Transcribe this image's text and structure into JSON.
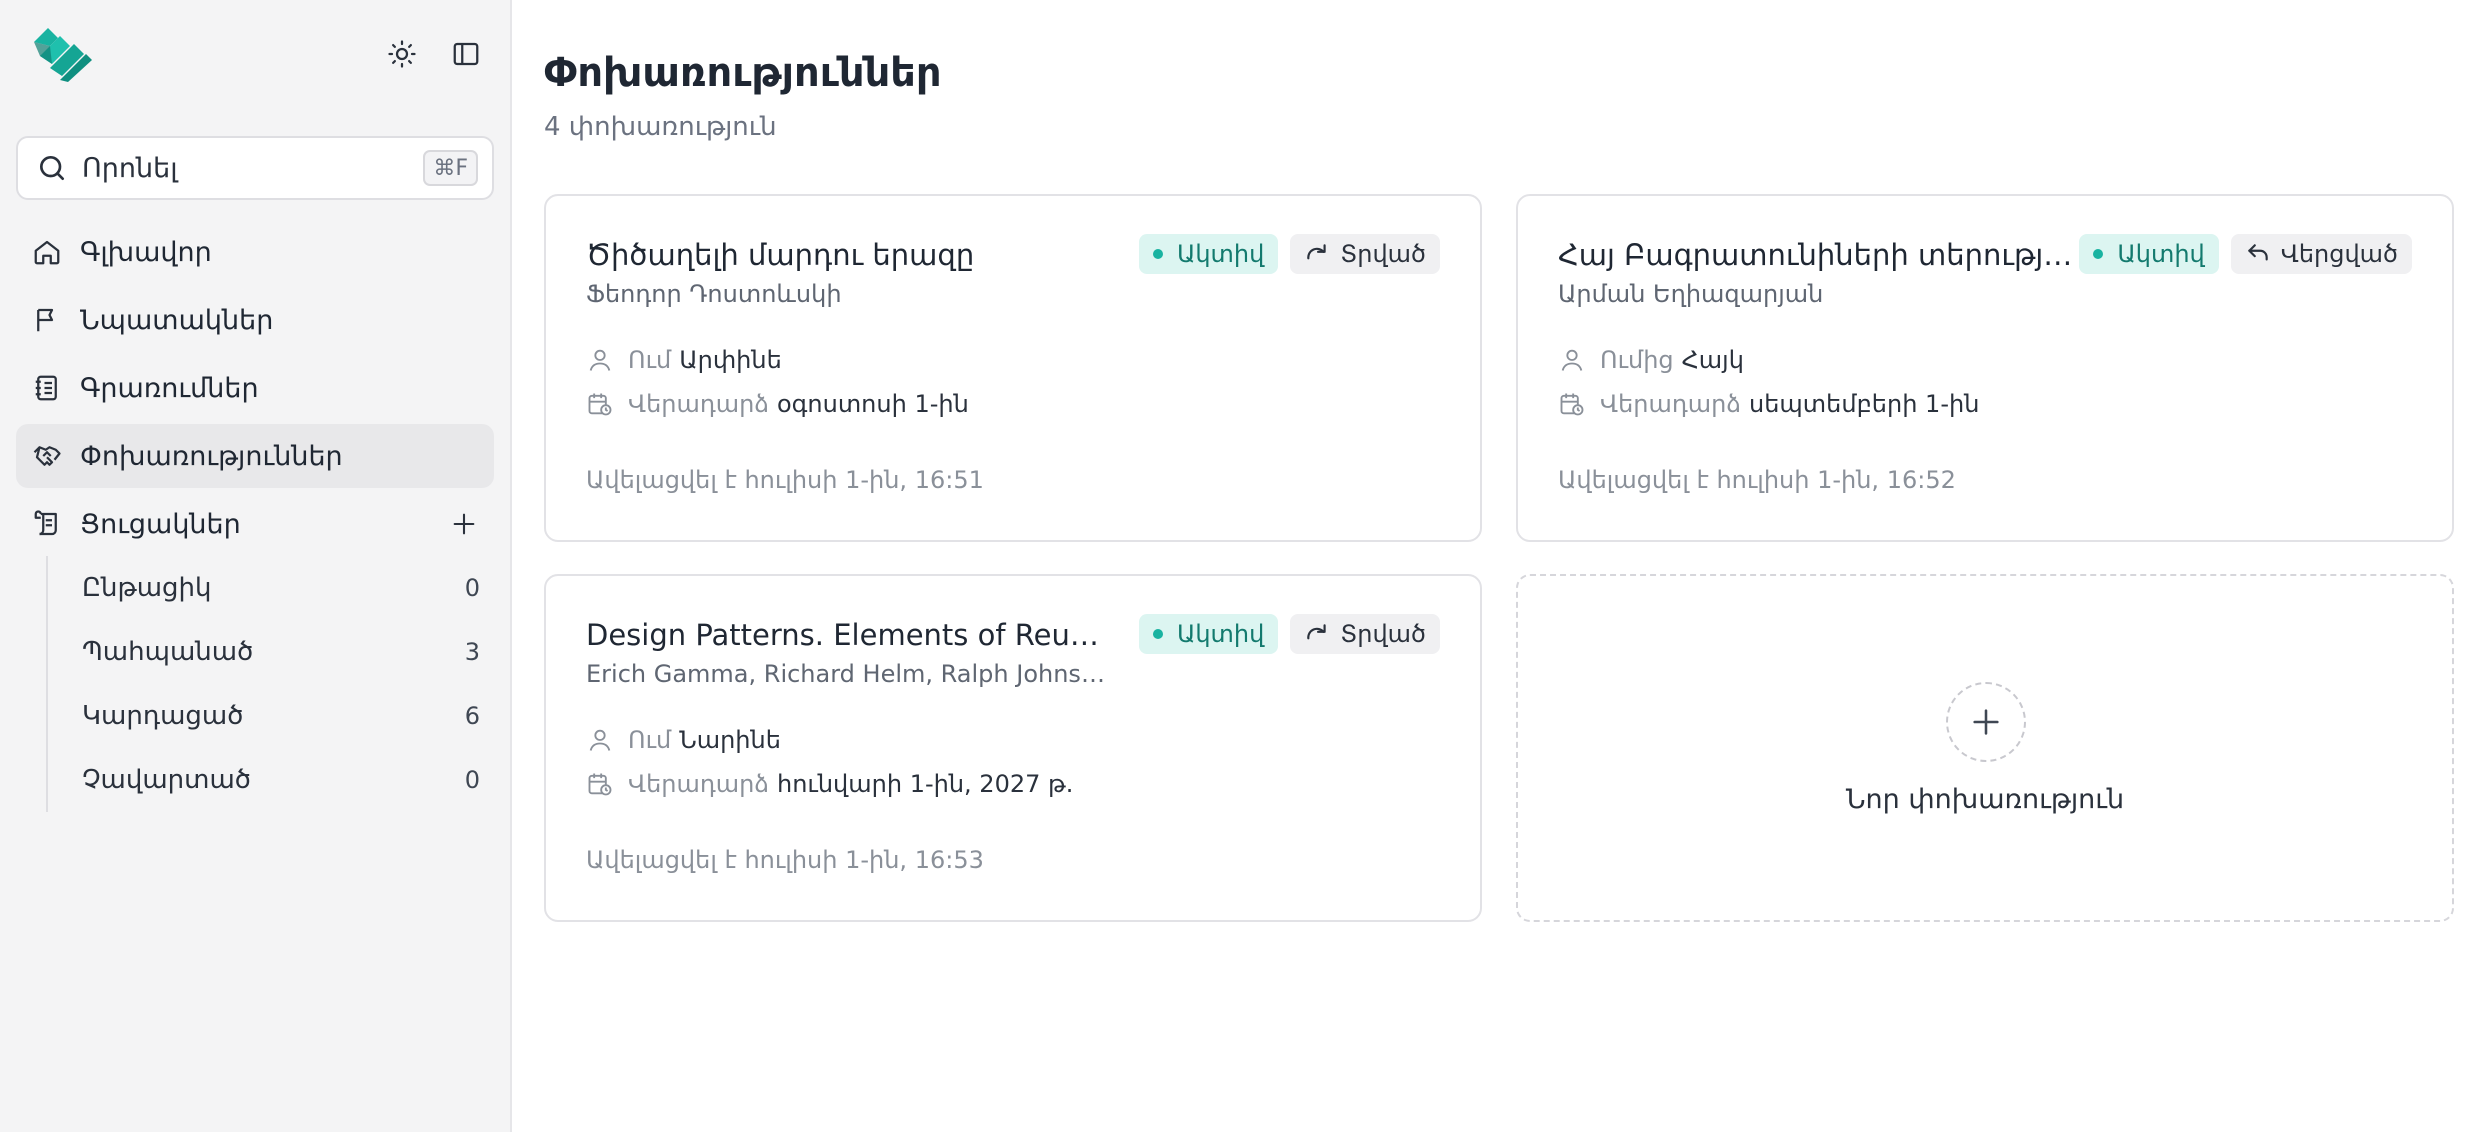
{
  "sidebar": {
    "search": {
      "placeholder": "Որոնել",
      "shortcut": "⌘F"
    },
    "nav": [
      {
        "label": "Գլխավոր",
        "icon": "home-icon",
        "active": false
      },
      {
        "label": "Նպատակներ",
        "icon": "flag-icon",
        "active": false
      },
      {
        "label": "Գրառումներ",
        "icon": "notebook-icon",
        "active": false
      },
      {
        "label": "Փոխառություններ",
        "icon": "handshake-icon",
        "active": true
      },
      {
        "label": "Ցուցակներ",
        "icon": "scroll-icon",
        "active": false
      }
    ],
    "lists": [
      {
        "label": "Ընթացիկ",
        "count": "0"
      },
      {
        "label": "Պահպանած",
        "count": "3"
      },
      {
        "label": "Կարդացած",
        "count": "6"
      },
      {
        "label": "Չավարտած",
        "count": "0"
      }
    ]
  },
  "main": {
    "title": "Փոխառություններ",
    "subtitle": "4 փոխառություն",
    "cards": [
      {
        "title": "Ծիծաղելի մարդու երազը",
        "author": "Ֆեոդոր Դոստոևսկի",
        "status": "Ակտիվ",
        "kind": "Տրված",
        "kind_icon": "redo-icon",
        "person_label": "Ում",
        "person": "Արփինե",
        "return_label": "Վերադարձ",
        "return_date": "օգոստոսի 1-ին",
        "added": "Ավելացվել է հուլիսի 1-ին, 16:51"
      },
      {
        "title": "Հայ Բագրատունիների տերություն",
        "author": "Արման Եղիազարյան",
        "status": "Ակտիվ",
        "kind": "Վերցված",
        "kind_icon": "undo-icon",
        "person_label": "Ումից",
        "person": "Հայկ",
        "return_label": "Վերադարձ",
        "return_date": "սեպտեմբերի 1-ին",
        "added": "Ավելացվել է հուլիսի 1-ին, 16:52"
      },
      {
        "title": "Design Patterns. Elements of Reusable Object-Oriented Software",
        "author": "Erich Gamma, Richard Helm, Ralph Johnson, John Vlissides",
        "status": "Ակտիվ",
        "kind": "Տրված",
        "kind_icon": "redo-icon",
        "person_label": "Ում",
        "person": "Նարինե",
        "return_label": "Վերադարձ",
        "return_date": "հունվարի 1-ին, 2027 թ.",
        "added": "Ավելացվել է հուլիսի 1-ին, 16:53"
      }
    ],
    "new_card_label": "Նոր փոխառություն"
  },
  "colors": {
    "accent": "#19b3a1",
    "status_bg": "#dcf5f1",
    "status_text": "#137a6e"
  }
}
